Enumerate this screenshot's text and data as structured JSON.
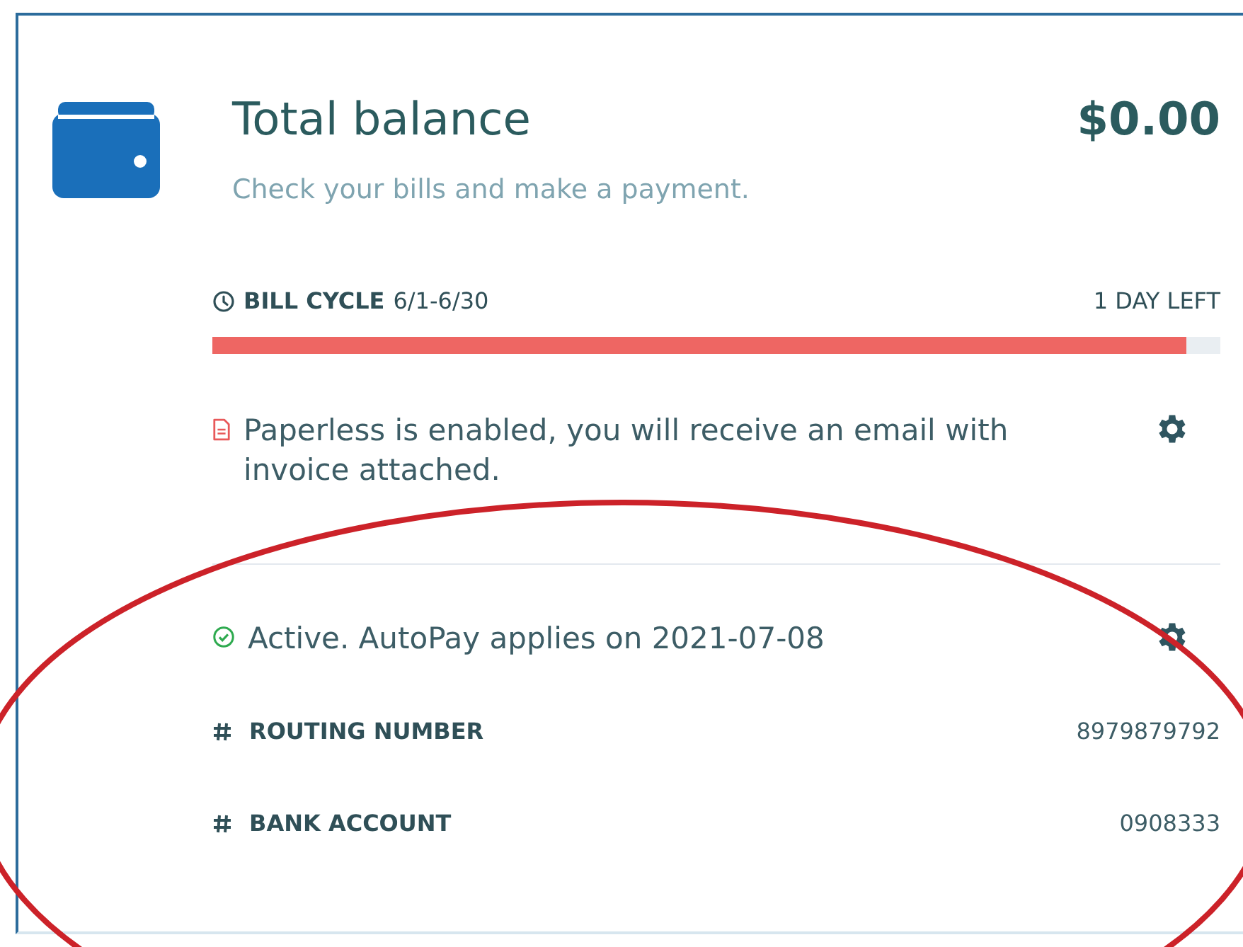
{
  "header": {
    "title": "Total balance",
    "amount": "$0.00",
    "subtitle": "Check your bills and make a payment."
  },
  "bill_cycle": {
    "label": "BILL CYCLE",
    "dates": "6/1-6/30",
    "remaining": "1 DAY LEFT",
    "level": 0.966
  },
  "notices": [
    {
      "kind": "document",
      "text": "Paperless is enabled, you will receive an email with invoice attached."
    },
    {
      "kind": "check",
      "text": "Active. AutoPay applies on 2021-07-08"
    }
  ],
  "fields": [
    {
      "label": "ROUTING NUMBER",
      "value": "8979879792"
    },
    {
      "label": "BANK ACCOUNT",
      "value": "0908333"
    }
  ]
}
